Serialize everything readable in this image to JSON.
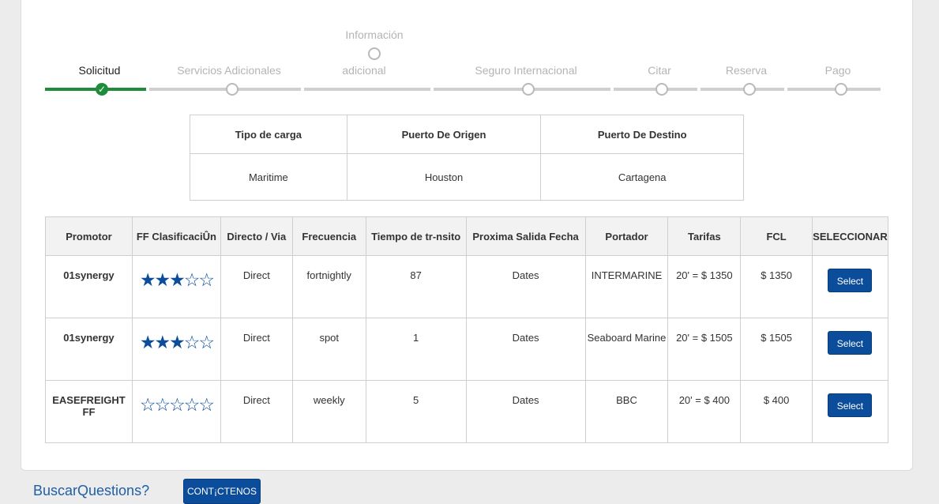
{
  "steps": [
    {
      "label": "Solicitud"
    },
    {
      "label": "Servicios Adicionales"
    },
    {
      "label_line1": "Información",
      "label_line2": "adicional"
    },
    {
      "label": "Seguro Internacional"
    },
    {
      "label": "Citar"
    },
    {
      "label": "Reserva"
    },
    {
      "label": "Pago"
    }
  ],
  "summary": {
    "headers": [
      "Tipo de carga",
      "Puerto De Origen",
      "Puerto De Destino"
    ],
    "values": [
      "Maritime",
      "Houston",
      "Cartagena"
    ]
  },
  "results": {
    "headers": [
      "Promotor",
      "FF ClasificaciÛn",
      "Directo / Via",
      "Frecuencia",
      "Tiempo de tr-nsito",
      "Proxima Salida Fecha",
      "Portador",
      "Tarifas",
      "FCL",
      "SELECCIONAR"
    ],
    "rows": [
      {
        "promotor": "01synergy",
        "rating": 3,
        "stars": "★★★☆☆",
        "route": "Direct",
        "frequency": "fortnightly",
        "transit": "87",
        "dates": "Dates",
        "carrier": "INTERMARINE",
        "tarifa": "20' = $ 1350",
        "fcl": "$ 1350",
        "select": "Select"
      },
      {
        "promotor": "01synergy",
        "rating": 3,
        "stars": "★★★☆☆",
        "route": "Direct",
        "frequency": "spot",
        "transit": "1",
        "dates": "Dates",
        "carrier": "Seaboard Marine",
        "tarifa": "20' = $ 1505",
        "fcl": "$ 1505",
        "select": "Select"
      },
      {
        "promotor": "EASEFREIGHT FF",
        "rating": 0,
        "stars": "☆☆☆☆☆",
        "route": "Direct",
        "frequency": "weekly",
        "transit": "5",
        "dates": "Dates",
        "carrier": "BBC",
        "tarifa": "20' = $ 400",
        "fcl": "$ 400",
        "select": "Select"
      }
    ]
  },
  "footer": {
    "question": "BuscarQuestions?",
    "contact": "CONT¡CTENOS"
  },
  "colors": {
    "accent": "#0b4d9b",
    "done": "#1e8c3a",
    "link": "#2a6bb2"
  }
}
